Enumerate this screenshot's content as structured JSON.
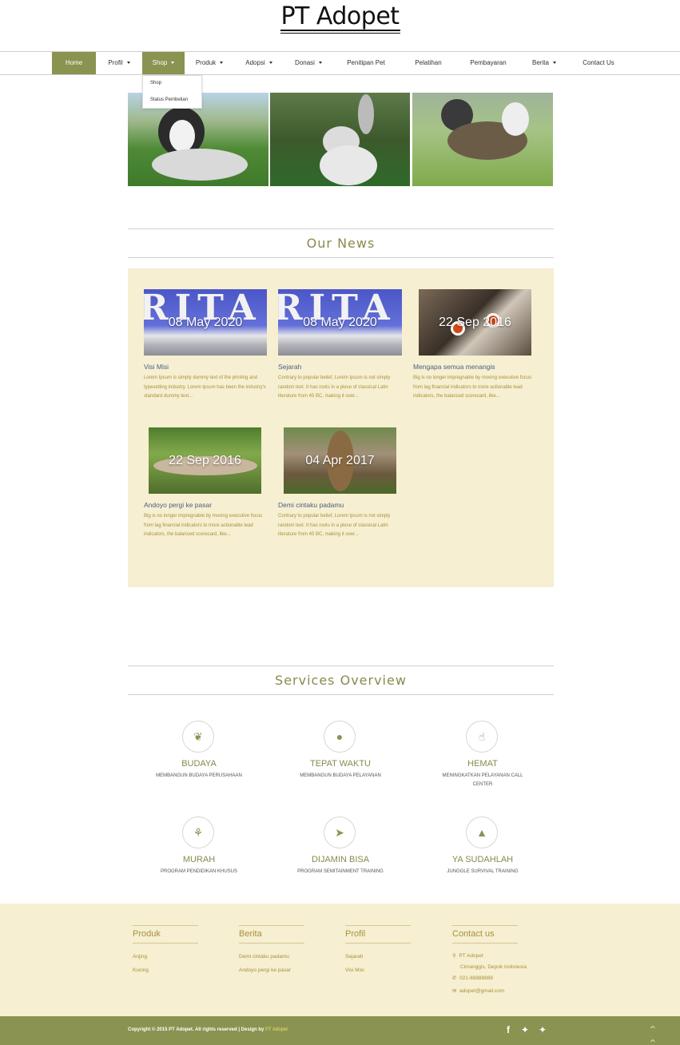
{
  "brand": {
    "title": "PT Adopet"
  },
  "nav": {
    "items": [
      {
        "label": "Home"
      },
      {
        "label": "Profil"
      },
      {
        "label": "Shop"
      },
      {
        "label": "Produk"
      },
      {
        "label": "Adopsi"
      },
      {
        "label": "Donasi"
      },
      {
        "label": "Penitipan Pet"
      },
      {
        "label": "Pelatihan"
      },
      {
        "label": "Pembayaran"
      },
      {
        "label": "Berita"
      },
      {
        "label": "Contact Us"
      }
    ],
    "active": "Home",
    "open_dropdown": "Shop",
    "dropdown": [
      "Shop",
      "Status Pembelian"
    ]
  },
  "news": {
    "title": "Our News",
    "cards": [
      {
        "date": "08 May 2020",
        "thumb_text": "RITA",
        "title": "Visi Misi",
        "text": "Lorem Ipsum is simply dummy text of the printing and typesetting industry. Lorem Ipsum has been the industry's standard dummy text..."
      },
      {
        "date": "08 May 2020",
        "thumb_text": "RITA",
        "title": "Sejarah",
        "text": "Contrary to popular belief, Lorem Ipsum is not simply random text. It has roots in a piece of classical Latin literature from 45 BC, making it over..."
      },
      {
        "date": "22 Sep 2016",
        "title": "Mengapa semua menangis",
        "text": "Big is no longer impregnable by moving executive focus from lag financial indicators to more actionable lead indicators, the balanced scorecard, like..."
      },
      {
        "date": "22 Sep 2016",
        "title": "Andoyo pergi ke pasar",
        "text": "Big is no longer impregnable by moving executive focus from lag financial indicators to more actionable lead indicators, the balanced scorecard, like..."
      },
      {
        "date": "04 Apr 2017",
        "title": "Demi cintaku padamu",
        "text": "Contrary to popular belief, Lorem Ipsum is not simply random text. It has roots in a piece of classical Latin literature from 45 BC, making it over..."
      }
    ]
  },
  "services": {
    "title": "Services Overview",
    "items": [
      {
        "icon": "leaf-icon",
        "title": "BUDAYA",
        "sub": "MEMBANGUN BUDAYA PERUSAHAAN"
      },
      {
        "icon": "globe-icon",
        "title": "TEPAT WAKTU",
        "sub": "MEMBANGUN BUDAYA PELAYANAN"
      },
      {
        "icon": "thumbs-up-icon",
        "title": "HEMAT",
        "sub": "MENINGKATKAN PELAYANAN CALL CENTER"
      },
      {
        "icon": "plant-icon",
        "title": "MURAH",
        "sub": "PROGRAM PENDIDIKAN KHUSUS"
      },
      {
        "icon": "paper-plane-icon",
        "title": "DIJAMIN BISA",
        "sub": "PROGRAM SEMITAINMENT TRAINING"
      },
      {
        "icon": "graduation-cap-icon",
        "title": "YA SUDAHLAH",
        "sub": "JUNGGLE SURVIVAL TRAINING"
      }
    ]
  },
  "footer": {
    "produk": {
      "title": "Produk",
      "links": [
        "Anjing",
        "Kucing"
      ]
    },
    "berita": {
      "title": "Berita",
      "links": [
        "Demi cintaku padamu",
        "Andoyo pergi ke pasar"
      ]
    },
    "profil": {
      "title": "Profil",
      "links": [
        "Sejarah",
        "Visi Misi"
      ]
    },
    "contact": {
      "title": "Contact us",
      "company": "PT Adopet",
      "address": "Cimanggis, Depok Indonesia",
      "phone": "021-88888888",
      "email": "adopet@gmail.com"
    },
    "copyright": "Copyright © 2015 PT Adopet. All rights reserved | Design by",
    "designer": "PT Adopet"
  },
  "colors": {
    "accent": "#8a9350",
    "cream": "#f6efd1",
    "gold": "#a8913a"
  }
}
